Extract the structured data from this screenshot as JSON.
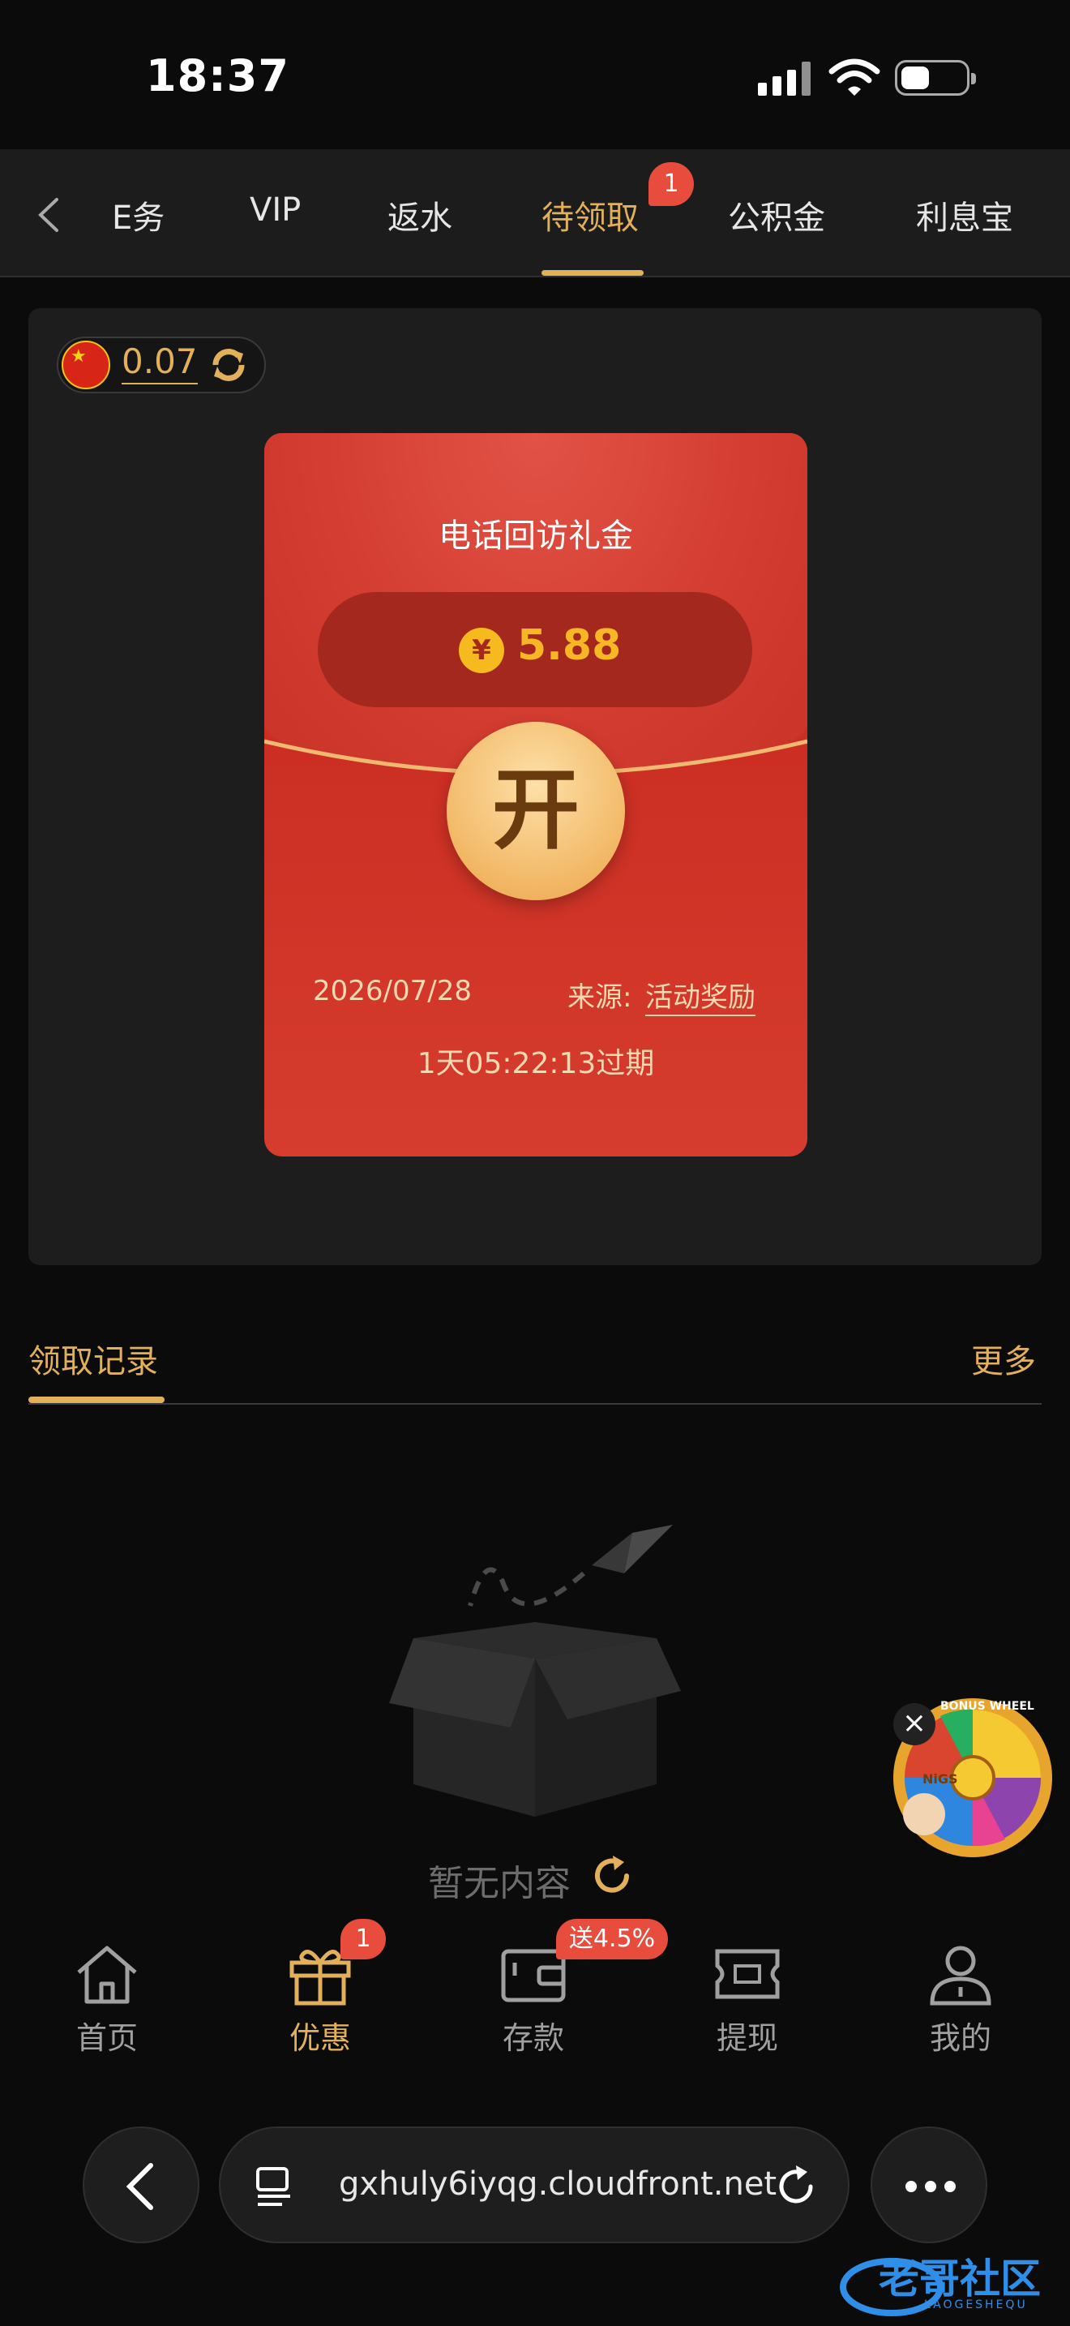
{
  "status_bar": {
    "time": "18:37"
  },
  "tabs": {
    "items": [
      {
        "label": "E务"
      },
      {
        "label": "VIP"
      },
      {
        "label": "返水"
      },
      {
        "label": "待领取"
      },
      {
        "label": "公积金"
      },
      {
        "label": "利息宝"
      }
    ],
    "active_index": 3,
    "badge": "1"
  },
  "balance": {
    "value": "0.07",
    "currency_icon": "china-flag-icon"
  },
  "red_envelope": {
    "title": "电话回访礼金",
    "currency_symbol": "¥",
    "amount": "5.88",
    "open_label": "开",
    "date": "2026/07/28",
    "source_label": "来源:",
    "source_value": "活动奖励",
    "expiry": "1天05:22:13过期"
  },
  "records": {
    "title": "领取记录",
    "more": "更多",
    "empty_text": "暂无内容"
  },
  "wheel": {
    "text_top": "BONUS WHEEL",
    "center": "NiGS"
  },
  "bottom_nav": {
    "items": [
      {
        "label": "首页",
        "icon": "home-icon"
      },
      {
        "label": "优惠",
        "icon": "gift-icon",
        "badge": "1"
      },
      {
        "label": "存款",
        "icon": "wallet-icon",
        "badge": "送4.5%"
      },
      {
        "label": "提现",
        "icon": "cash-icon"
      },
      {
        "label": "我的",
        "icon": "user-icon"
      }
    ],
    "active_index": 1
  },
  "browser": {
    "url": "gxhuly6iyqg.cloudfront.net"
  },
  "watermark": {
    "text": "老哥社区",
    "sub": "LAOGESHEQU"
  },
  "colors": {
    "accent": "#e2b05a",
    "envelope_red": "#d33c30",
    "badge_red": "#e74c3c",
    "background": "#0b0b0b"
  }
}
